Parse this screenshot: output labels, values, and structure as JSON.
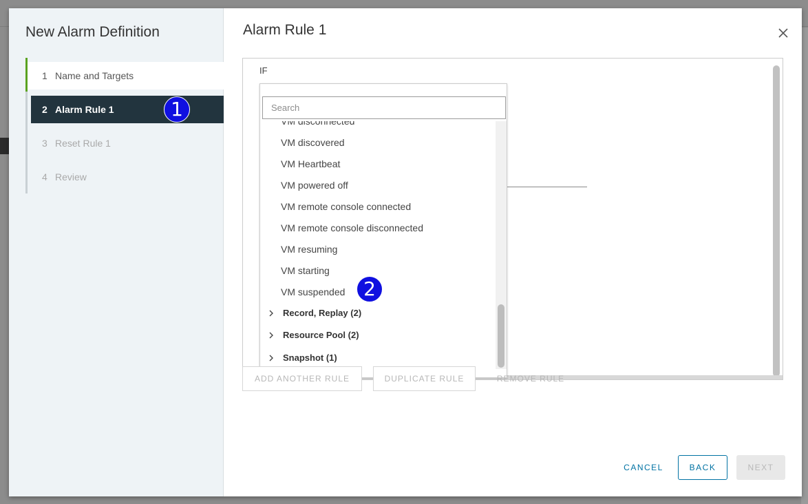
{
  "sidebar": {
    "title": "New Alarm Definition",
    "steps": [
      {
        "num": "1",
        "label": "Name and Targets"
      },
      {
        "num": "2",
        "label": "Alarm Rule 1"
      },
      {
        "num": "3",
        "label": "Reset Rule 1"
      },
      {
        "num": "4",
        "label": "Review"
      }
    ]
  },
  "annotations": [
    "1",
    "2"
  ],
  "main": {
    "title": "Alarm Rule 1",
    "if_label": "IF"
  },
  "dropdown": {
    "search_placeholder": "Search",
    "items": [
      "VM disconnected",
      "VM discovered",
      "VM Heartbeat",
      "VM powered off",
      "VM remote console connected",
      "VM remote console disconnected",
      "VM resuming",
      "VM starting",
      "VM suspended"
    ],
    "groups": [
      "Record, Replay (2)",
      "Resource Pool (2)",
      "Snapshot (1)"
    ]
  },
  "rule_actions": {
    "add_label": "ADD ANOTHER RULE",
    "duplicate_label": "DUPLICATE RULE",
    "remove_label": "REMOVE RULE"
  },
  "footer": {
    "cancel_label": "CANCEL",
    "back_label": "BACK",
    "next_label": "NEXT"
  },
  "colors": {
    "accent": "#0072a3",
    "active_step_bg": "#22343e",
    "progress_green": "#5aa220",
    "annotation_badge": "#1010e0"
  },
  "icons": {
    "close": "close-icon",
    "group_expand": "chevron-right-icon"
  }
}
